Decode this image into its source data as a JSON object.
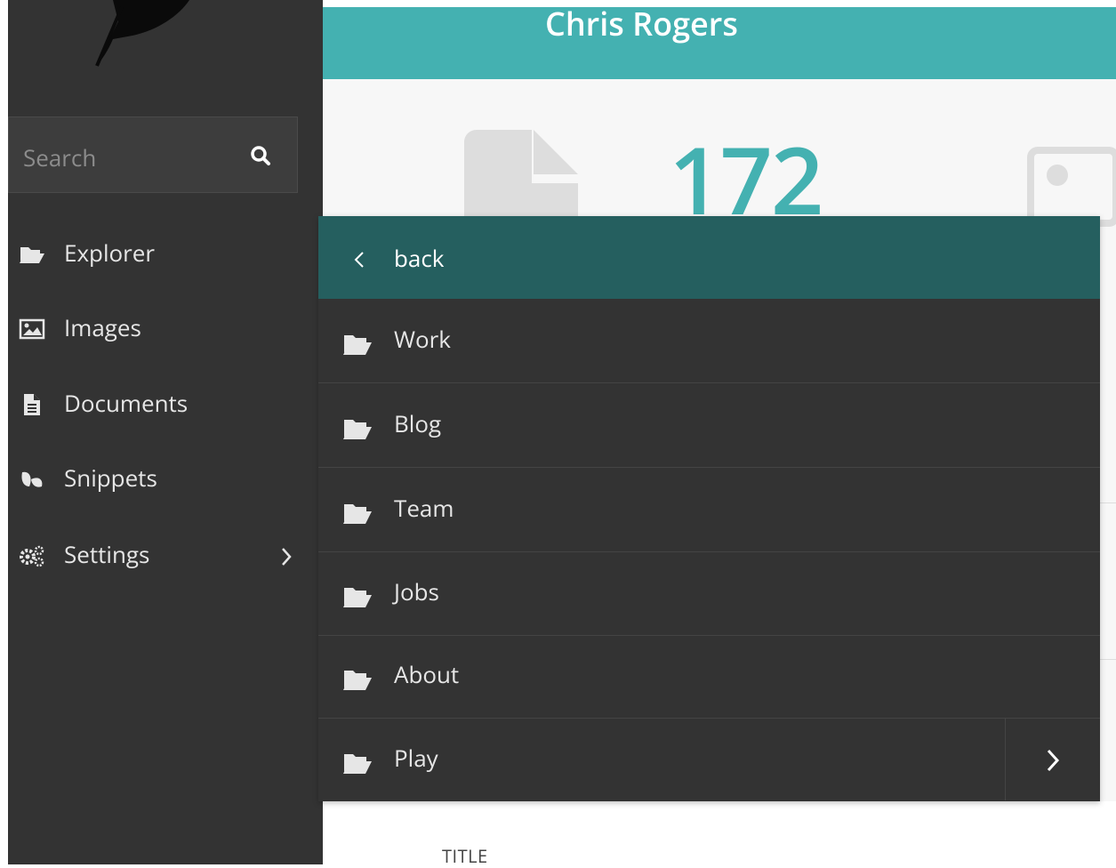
{
  "header": {
    "user_name": "Chris Rogers"
  },
  "sidebar": {
    "search_placeholder": "Search",
    "items": [
      {
        "label": "Explorer",
        "icon": "folder-open-icon"
      },
      {
        "label": "Images",
        "icon": "image-icon"
      },
      {
        "label": "Documents",
        "icon": "document-icon"
      },
      {
        "label": "Snippets",
        "icon": "leaf-icon"
      },
      {
        "label": "Settings",
        "icon": "gears-icon",
        "has_submenu": true
      }
    ]
  },
  "main": {
    "stat_value": "172",
    "column_title": "TITLE"
  },
  "panel": {
    "back_label": "back",
    "folders": [
      {
        "label": "Work"
      },
      {
        "label": "Blog"
      },
      {
        "label": "Team"
      },
      {
        "label": "Jobs"
      },
      {
        "label": "About"
      },
      {
        "label": "Play",
        "has_submenu": true
      }
    ]
  },
  "colors": {
    "accent": "#44b1b1",
    "panel_header": "#255f5f",
    "sidebar_bg": "#333333"
  }
}
